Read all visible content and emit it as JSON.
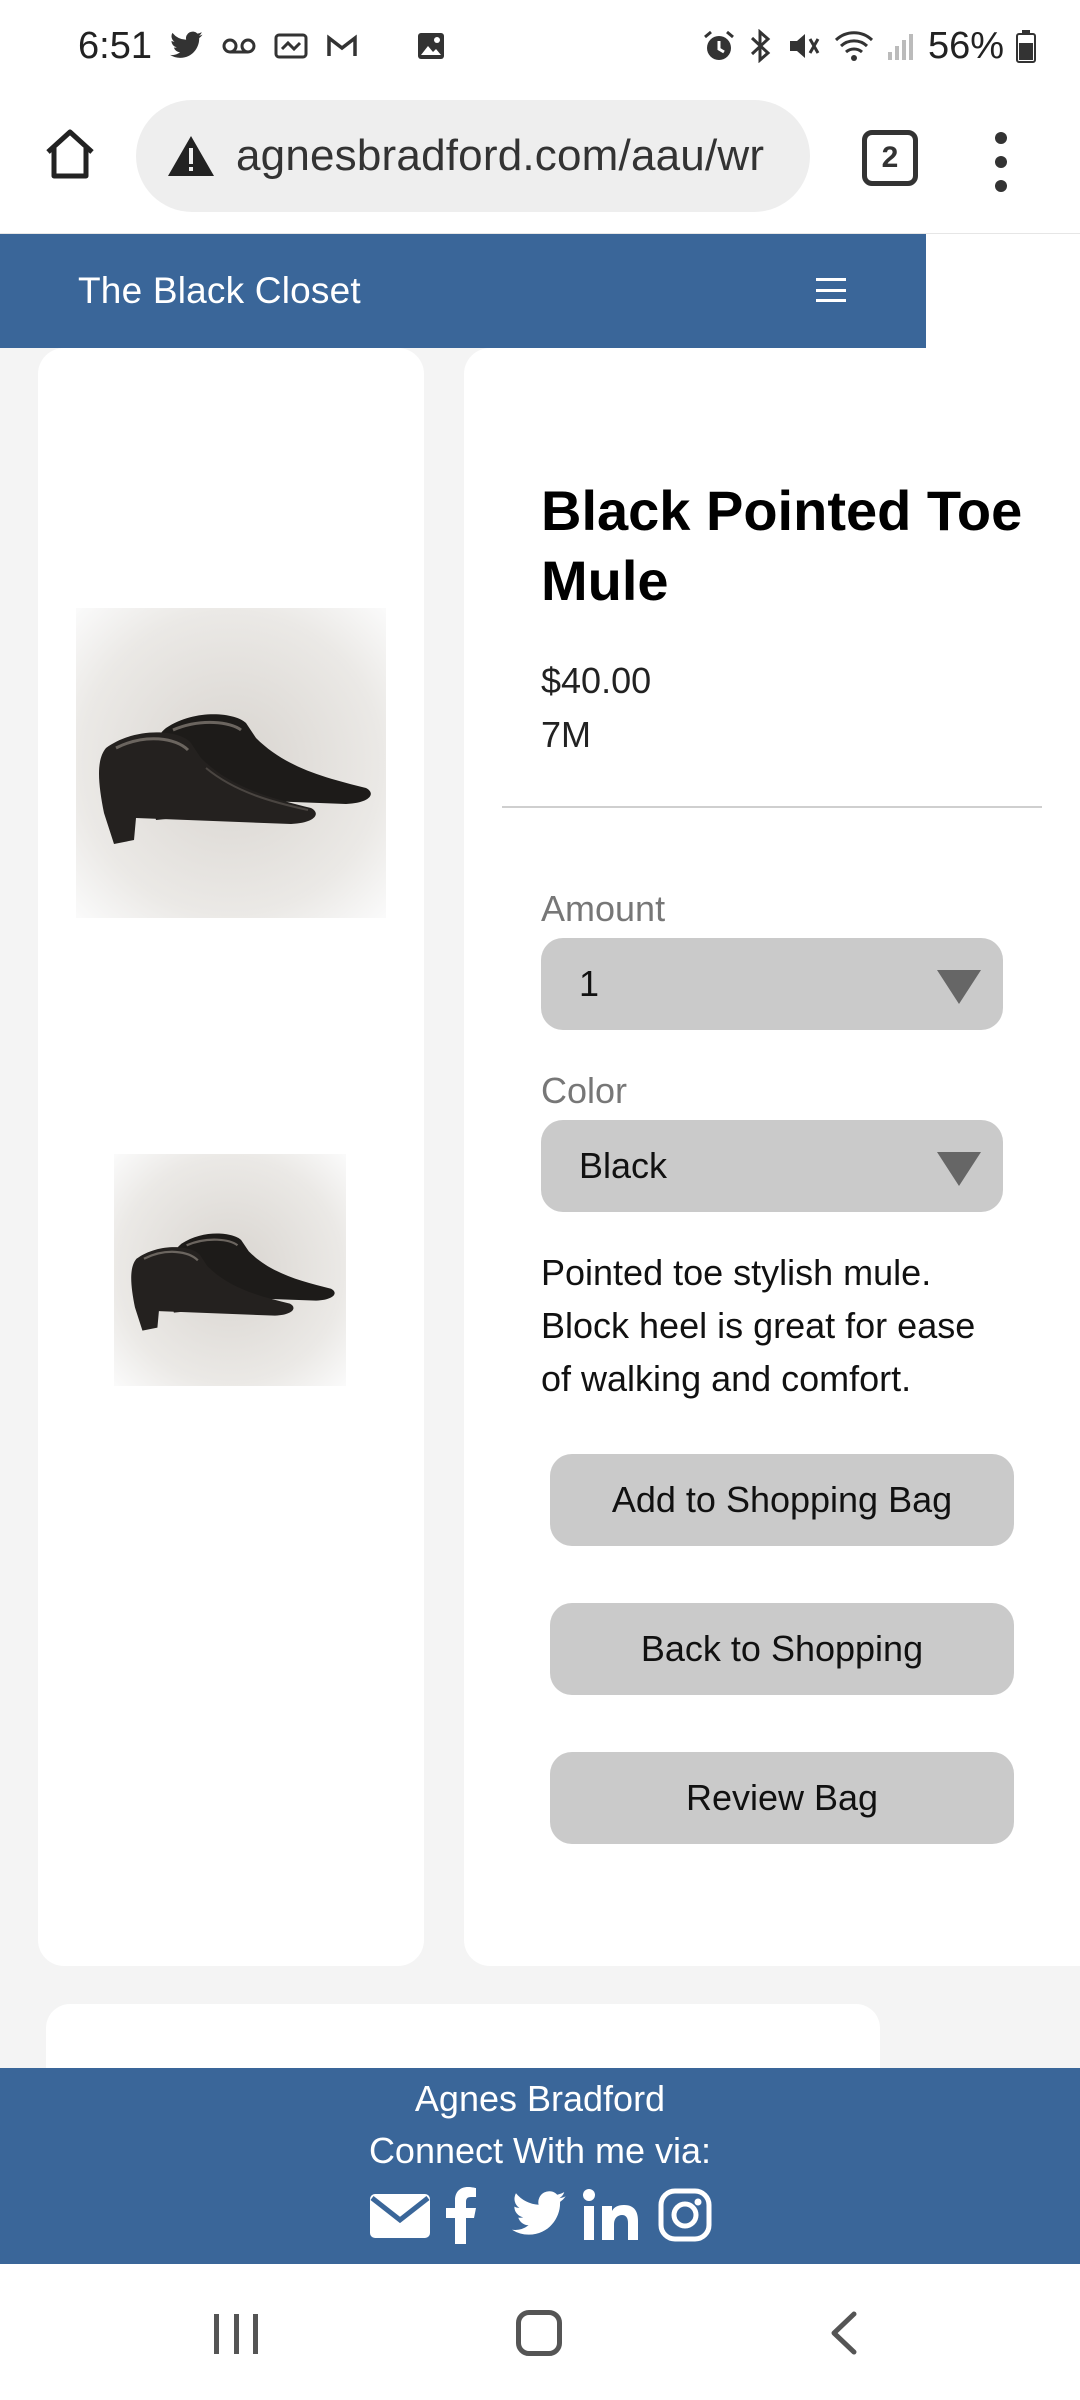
{
  "status_bar": {
    "time": "6:51",
    "battery": "56%",
    "notification_icons": [
      "twitter-icon",
      "voicemail-icon",
      "missed-call-icon",
      "gmail-icon",
      "image-icon"
    ],
    "system_icons": [
      "alarm-icon",
      "bluetooth-icon",
      "mute-icon",
      "wifi-icon",
      "signal-icon",
      "battery-icon"
    ]
  },
  "browser": {
    "url": "agnesbradford.com/aau/wr",
    "tab_count": "2",
    "security_icon": "warning-icon"
  },
  "site": {
    "brand": "The Black Closet",
    "menu_icon": "hamburger-icon"
  },
  "product": {
    "title": "Black Pointed Toe Mule",
    "price": "$40.00",
    "size": "7M",
    "amount_label": "Amount",
    "amount_value": "1",
    "color_label": "Color",
    "color_value": "Black",
    "description": "Pointed toe stylish mule. Block heel is great for ease of walking and comfort.",
    "buttons": {
      "add": "Add to Shopping Bag",
      "back": "Back to Shopping",
      "review": "Review Bag"
    }
  },
  "footer": {
    "name": "Agnes Bradford",
    "connect": "Connect With me via:",
    "social_icons": [
      "email-icon",
      "facebook-icon",
      "twitter-icon",
      "linkedin-icon",
      "instagram-icon"
    ]
  },
  "colors": {
    "brand_blue": "#3a6699",
    "button_gray": "#cacaca"
  }
}
